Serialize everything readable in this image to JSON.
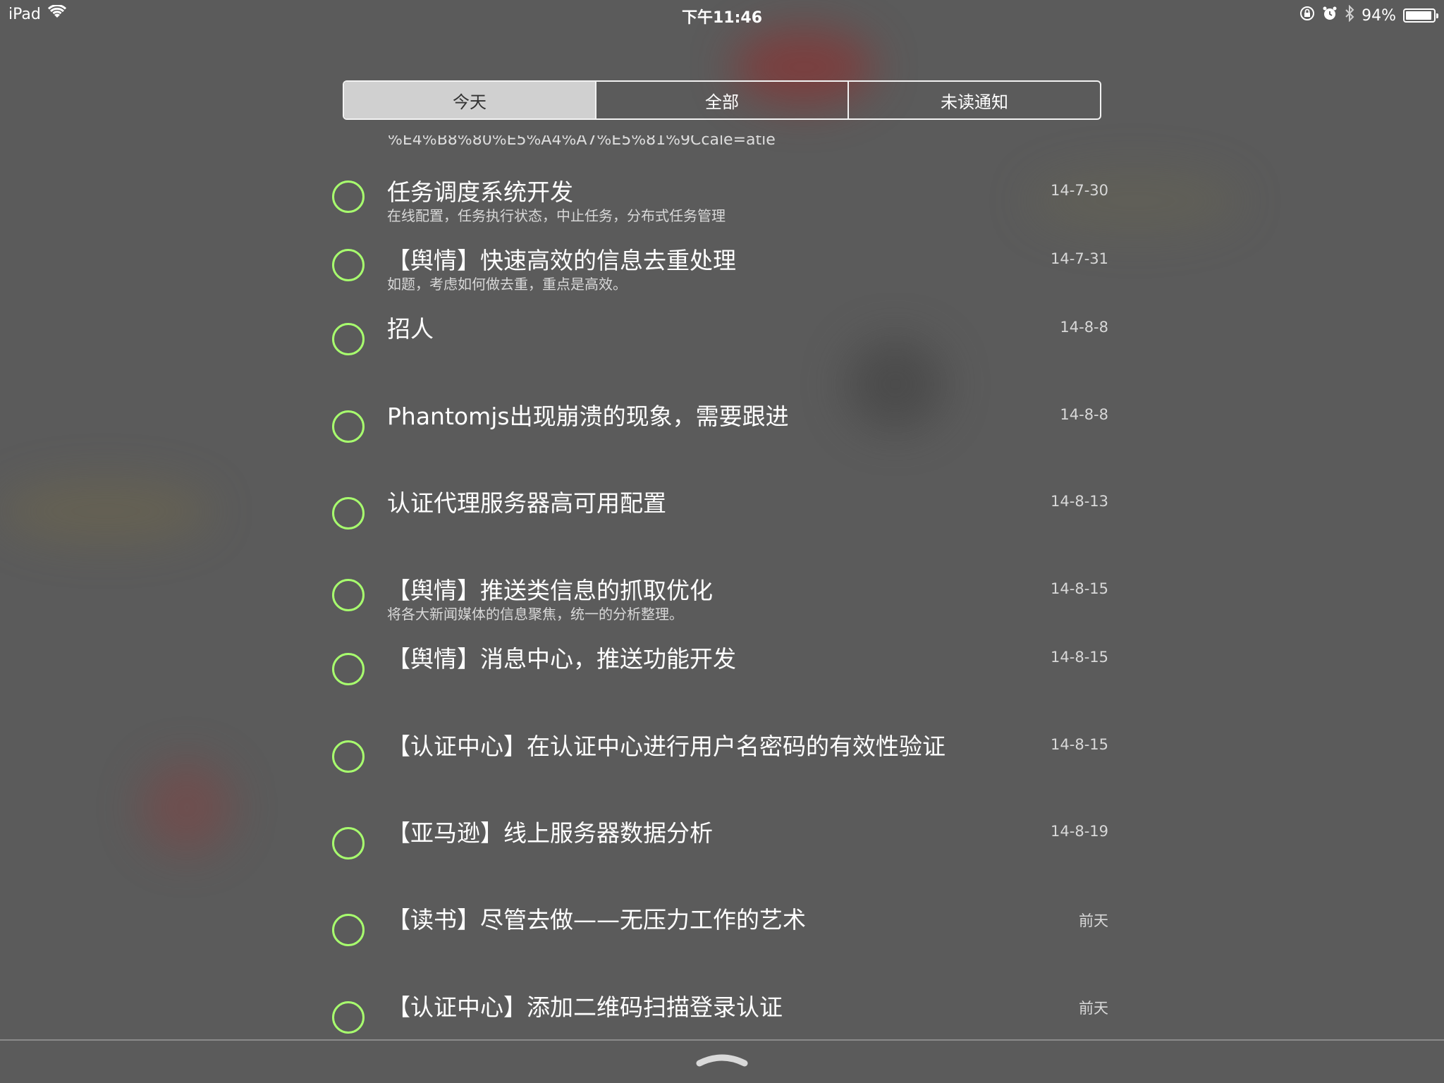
{
  "status_bar": {
    "device": "iPad",
    "time": "下午11:46",
    "battery": "94%",
    "battery_level": 0.94,
    "icons": [
      "wifi-icon",
      "rotation-lock-icon",
      "alarm-icon",
      "bluetooth-icon",
      "battery-icon"
    ]
  },
  "tabs": [
    {
      "label": "今天",
      "active": true
    },
    {
      "label": "全部",
      "active": false
    },
    {
      "label": "未读通知",
      "active": false
    }
  ],
  "cutoff_text": "%E4%B8%80%E5%A4%A7%E5%81%9Ccale=atie",
  "items": [
    {
      "title": "任务调度系统开发",
      "subtitle": "在线配置，任务执行状态，中止任务，分布式任务管理",
      "date": "14-7-30"
    },
    {
      "title": "【舆情】快速高效的信息去重处理",
      "subtitle": "如题，考虑如何做去重，重点是高效。",
      "date": "14-7-31"
    },
    {
      "title": "招人",
      "subtitle": "",
      "date": "14-8-8"
    },
    {
      "title": "Phantomjs出现崩溃的现象，需要跟进",
      "subtitle": "",
      "date": "14-8-8"
    },
    {
      "title": "认证代理服务器高可用配置",
      "subtitle": "",
      "date": "14-8-13"
    },
    {
      "title": "【舆情】推送类信息的抓取优化",
      "subtitle": "将各大新闻媒体的信息聚焦，统一的分析整理。",
      "date": "14-8-15"
    },
    {
      "title": "【舆情】消息中心，推送功能开发",
      "subtitle": "",
      "date": "14-8-15"
    },
    {
      "title": "【认证中心】在认证中心进行用户名密码的有效性验证",
      "subtitle": "",
      "date": "14-8-15"
    },
    {
      "title": "【亚马逊】线上服务器数据分析",
      "subtitle": "",
      "date": "14-8-19"
    },
    {
      "title": "【读书】尽管去做——无压力工作的艺术",
      "subtitle": "",
      "date": "前天"
    },
    {
      "title": "【认证中心】添加二维码扫描登录认证",
      "subtitle": "",
      "date": "前天"
    }
  ],
  "colors": {
    "background": "#5b5b5b",
    "checkbox_ring": "#a8ff6e",
    "segment_active_bg": "#d0d0d0",
    "text_primary": "#ffffff",
    "text_secondary": "#d8d8d8"
  }
}
